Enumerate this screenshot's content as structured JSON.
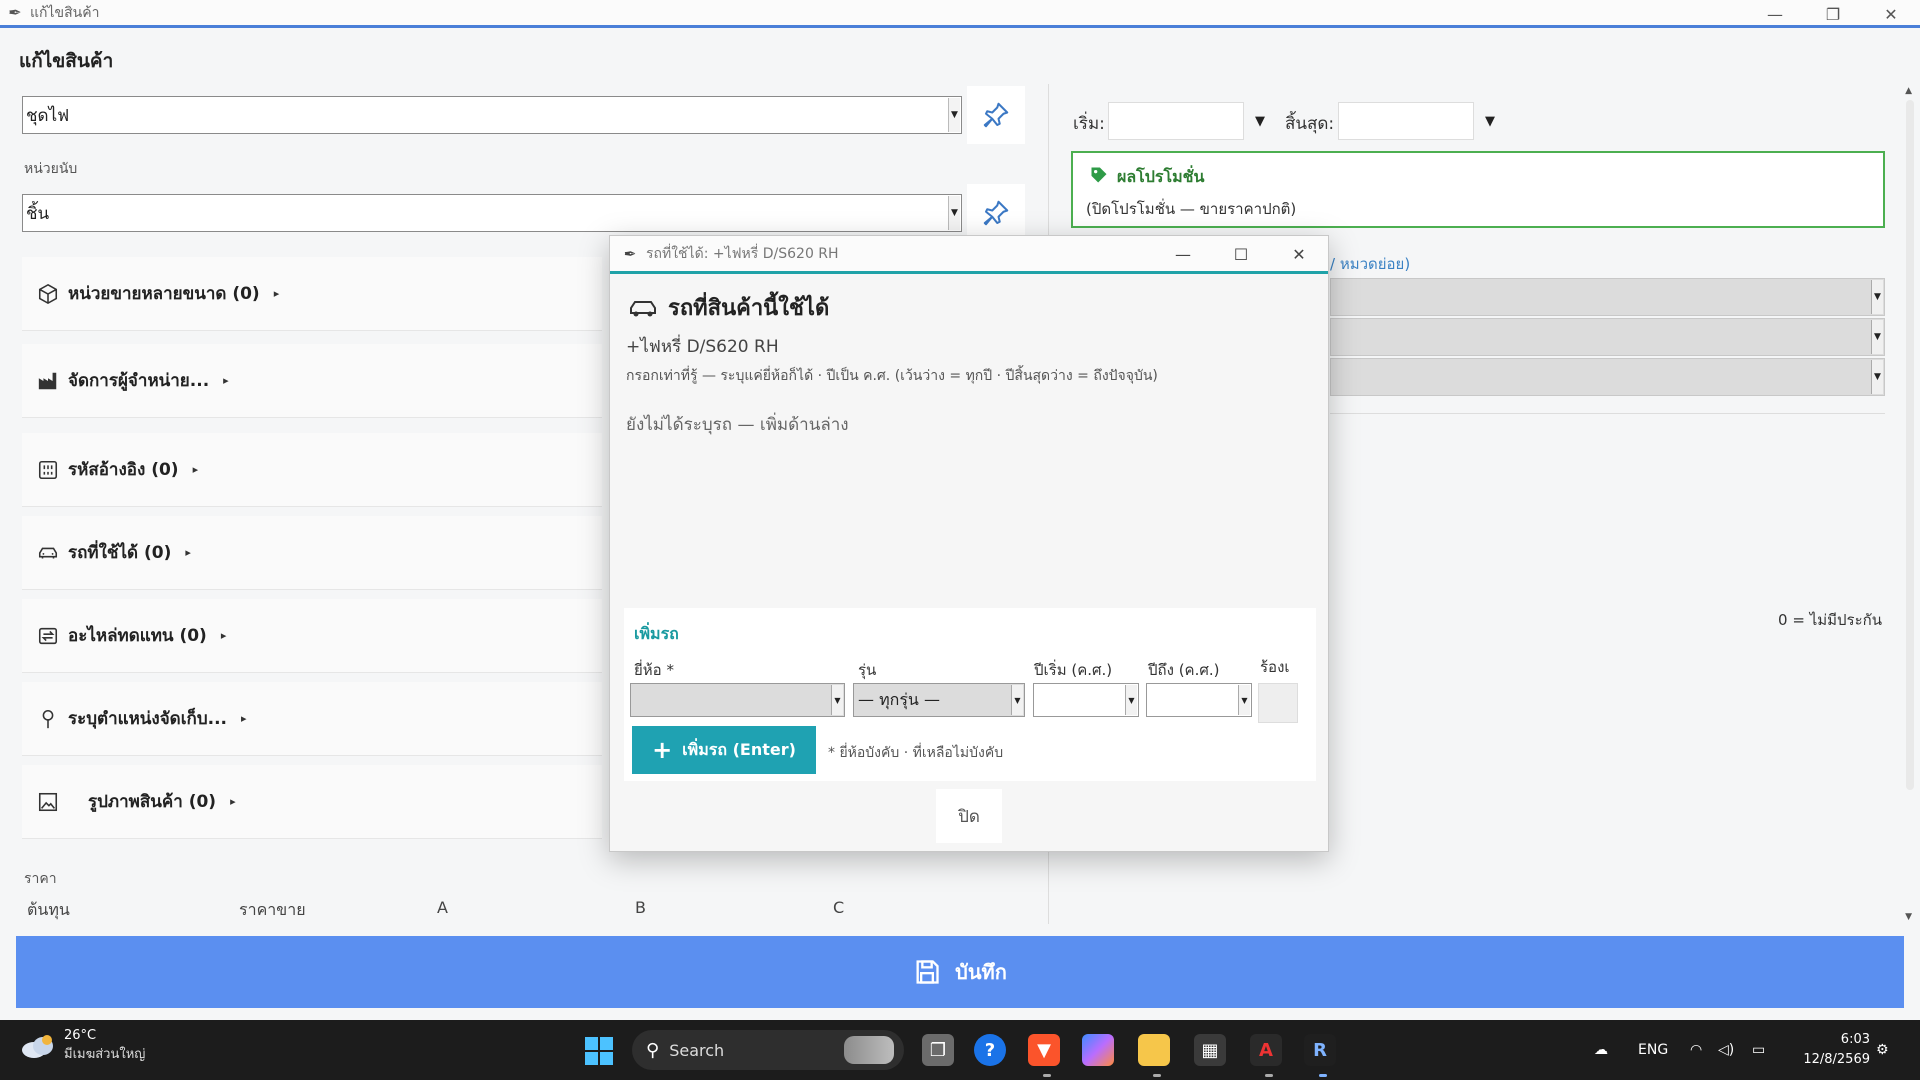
{
  "window": {
    "title": "แก้ไขสินค้า",
    "minimize": "—",
    "restore": "❐",
    "close": "✕"
  },
  "page": {
    "heading": "แก้ไขสินค้า"
  },
  "form": {
    "product_value": "ชุดไฟ",
    "unit_label": "หน่วยนับ",
    "unit_value": "ชิ้น"
  },
  "sections": [
    {
      "label": "หน่วยขายหลายขนาด (0)",
      "icon": "box-icon"
    },
    {
      "label": "จัดการผู้จำหน่าย...",
      "icon": "factory-icon"
    },
    {
      "label": "รหัสอ้างอิง (0)",
      "icon": "barcode-icon"
    },
    {
      "label": "รถที่ใช้ได้ (0)",
      "icon": "car-icon"
    },
    {
      "label": "อะไหล่ทดแทน (0)",
      "icon": "swap-icon"
    },
    {
      "label": "ระบุตำแหน่งจัดเก็บ...",
      "icon": "location-pin-icon"
    },
    {
      "label": "รูปภาพสินค้า (0)",
      "icon": "image-icon"
    }
  ],
  "section_caret": "▸",
  "price": {
    "label": "ราคา",
    "headers": [
      "ต้นทุน",
      "ราคาขาย",
      "A",
      "B",
      "C"
    ]
  },
  "right_panel": {
    "start_label": "เริ่ม:",
    "end_label": "สิ้นสุด:",
    "dropdown_glyph": "▼",
    "promo_title": "ผลโปรโมชั่น",
    "promo_text": "(ปิดโปรโมชั่น — ขายราคาปกติ)",
    "category_link": "/ หมวดย่อย)",
    "note": "0 = ไม่มีประกัน"
  },
  "save_button": {
    "label": "บันทึก"
  },
  "dialog": {
    "title": "รถที่ใช้ได้: +ไฟหรี่ D/S620 RH",
    "heading": "รถที่สินค้านี้ใช้ได้",
    "subtitle": "+ไฟหรี่ D/S620 RH",
    "hint": "กรอกเท่าที่รู้ — ระบุแค่ยี่ห้อก็ได้ · ปีเป็น ค.ศ. (เว้นว่าง = ทุกปี · ปีสิ้นสุดว่าง = ถึงปัจจุบัน)",
    "empty_text": "ยังไม่ได้ระบุรถ — เพิ่มด้านล่าง",
    "add_section": {
      "title": "เพิ่มรถ",
      "brand_label": "ยี่ห้อ *",
      "brand_value": "",
      "model_label": "รุ่น",
      "model_value": "— ทุกรุ่น —",
      "year_start_label": "ปีเริ่ม (ค.ศ.)",
      "year_start_value": "",
      "year_end_label": "ปีถึง (ค.ศ.)",
      "year_end_value": "",
      "extra_label": "ร้องเ",
      "add_button": "เพิ่มรถ  (Enter)",
      "note": "* ยี่ห้อบังคับ · ที่เหลือไม่บังคับ"
    },
    "close_button": "ปิด"
  },
  "taskbar": {
    "temperature": "26°C",
    "weather_desc": "มีเมฆส่วนใหญ่",
    "search_label": "Search",
    "language": "ENG",
    "time": "6:03",
    "date": "12/8/2569"
  },
  "colors": {
    "accent_blue": "#5b8ff0",
    "dialog_teal": "#1fa2b2",
    "promo_green": "#4caf50"
  }
}
